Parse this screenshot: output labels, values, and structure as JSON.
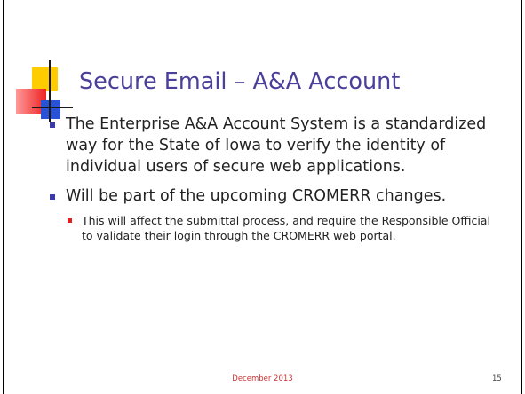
{
  "slide": {
    "title": "Secure Email – A&A Account",
    "bullets": [
      {
        "text": "The Enterprise A&A Account System is a standardized way for the State of Iowa to verify the identity of individual users of secure web applications."
      },
      {
        "text": "Will be part of the upcoming CROMERR changes.",
        "sub_bullets": [
          {
            "text": "This will affect the submittal process, and require the Responsible Official to validate their login through the CROMERR web portal."
          }
        ]
      }
    ],
    "footer_date": "December 2013",
    "page_number": "15"
  },
  "colors": {
    "title": "#4a3f9a",
    "bullet_marker": "#3a3aa8",
    "sub_bullet_marker": "#e02020",
    "footer_date": "#cc3333",
    "deco_yellow": "#ffcc00",
    "deco_red": "#ee2222",
    "deco_blue": "#2a52d6"
  }
}
